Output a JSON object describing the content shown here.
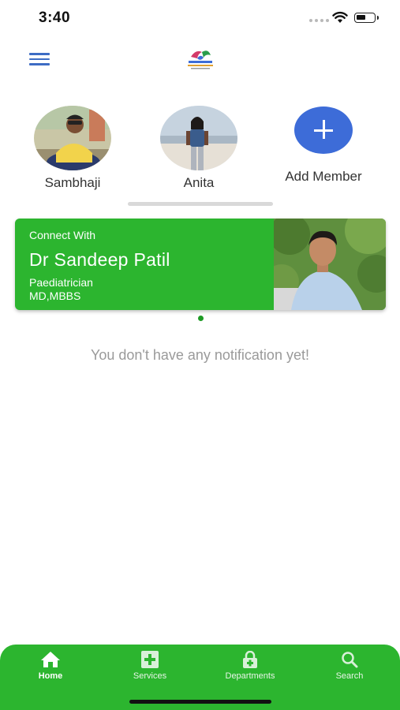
{
  "status_bar": {
    "time": "3:40"
  },
  "members": [
    {
      "name": "Sambhaji"
    },
    {
      "name": "Anita"
    }
  ],
  "add_member": {
    "label": "Add Member"
  },
  "doctor_card": {
    "connect_label": "Connect With",
    "doctor_name": "Dr Sandeep Patil",
    "specialty": "Paediatrician",
    "degrees": "MD,MBBS"
  },
  "notifications": {
    "empty_message": "You don't have any notification yet!"
  },
  "bottom_nav": {
    "items": [
      {
        "label": "Home",
        "icon": "home-icon",
        "active": true
      },
      {
        "label": "Services",
        "icon": "plus-square-icon",
        "active": false
      },
      {
        "label": "Departments",
        "icon": "lock-plus-icon",
        "active": false
      },
      {
        "label": "Search",
        "icon": "search-icon",
        "active": false
      }
    ]
  },
  "colors": {
    "accent_green": "#2cb52f",
    "accent_blue": "#3d6cd8",
    "muted_text": "#9a9a9a"
  }
}
